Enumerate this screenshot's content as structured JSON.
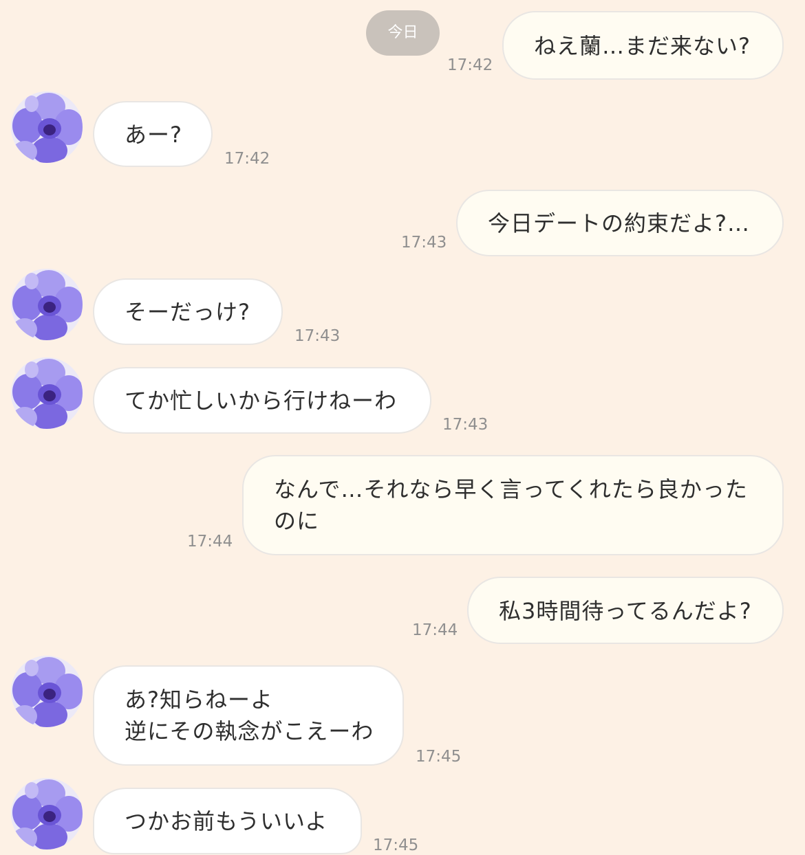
{
  "date_label": "今日",
  "colors": {
    "background": "#fdf1e5",
    "outgoing_bubble": "#fffcf2",
    "incoming_bubble": "#ffffff",
    "bubble_border": "#e9e6e3",
    "timestamp": "#8f8f8f",
    "date_pill": "#c9c2bb",
    "avatar_orchid": "#8a7ae8"
  },
  "contact": {
    "avatar_icon": "purple-orchid-avatar-icon"
  },
  "messages": [
    {
      "direction": "outgoing",
      "text": "ねえ蘭…まだ来ない?",
      "time": "17:42"
    },
    {
      "direction": "incoming",
      "text": "あー?",
      "time": "17:42"
    },
    {
      "direction": "outgoing",
      "text": "今日デートの約束だよ?…",
      "time": "17:43"
    },
    {
      "direction": "incoming",
      "text": "そーだっけ?",
      "time": "17:43"
    },
    {
      "direction": "incoming",
      "text": "てか忙しいから行けねーわ",
      "time": "17:43"
    },
    {
      "direction": "outgoing",
      "text": "なんで…それなら早く言ってくれたら良かった\nのに",
      "time": "17:44"
    },
    {
      "direction": "outgoing",
      "text": "私3時間待ってるんだよ?",
      "time": "17:44"
    },
    {
      "direction": "incoming",
      "text": "あ?知らねーよ\n逆にその執念がこえーわ",
      "time": "17:45"
    },
    {
      "direction": "incoming",
      "text": "つかお前もういいよ",
      "time": "17:45"
    }
  ]
}
